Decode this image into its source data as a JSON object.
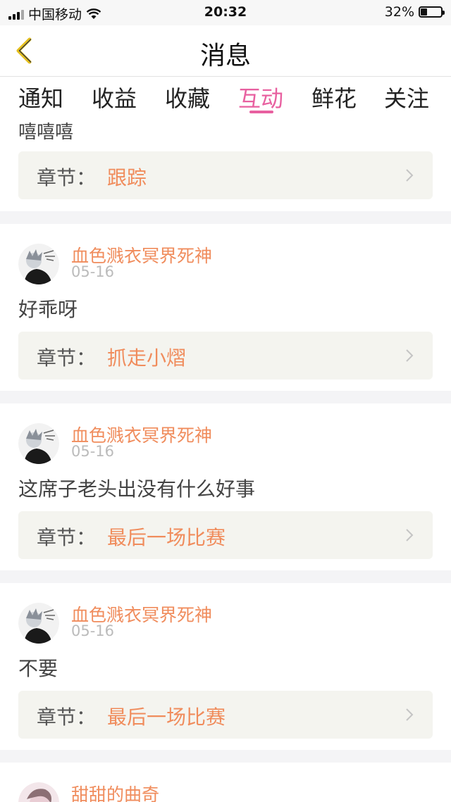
{
  "status_bar": {
    "carrier": "中国移动",
    "time": "20:32",
    "battery": "32%",
    "battery_level": 0.32
  },
  "nav": {
    "title": "消息"
  },
  "tabs": [
    {
      "label": "通知",
      "active": false
    },
    {
      "label": "收益",
      "active": false
    },
    {
      "label": "收藏",
      "active": false
    },
    {
      "label": "互动",
      "active": true
    },
    {
      "label": "鲜花",
      "active": false
    },
    {
      "label": "关注",
      "active": false
    }
  ],
  "chapter_label": "章节：",
  "items": [
    {
      "user": "",
      "date": "",
      "message": "嘻嘻嘻",
      "chapter": "跟踪"
    },
    {
      "user": "血色溅衣冥界死神",
      "date": "05-16",
      "message": "好乖呀",
      "chapter": "抓走小熠"
    },
    {
      "user": "血色溅衣冥界死神",
      "date": "05-16",
      "message": "这席子老头出没有什么好事",
      "chapter": "最后一场比赛"
    },
    {
      "user": "血色溅衣冥界死神",
      "date": "05-16",
      "message": "不要",
      "chapter": "最后一场比赛"
    },
    {
      "user": "甜甜的曲奇",
      "date": "",
      "message": "",
      "chapter": ""
    }
  ],
  "colors": {
    "accent": "#e860a0",
    "username": "#f08c5c",
    "chapter_bg": "#f4f4ef"
  }
}
